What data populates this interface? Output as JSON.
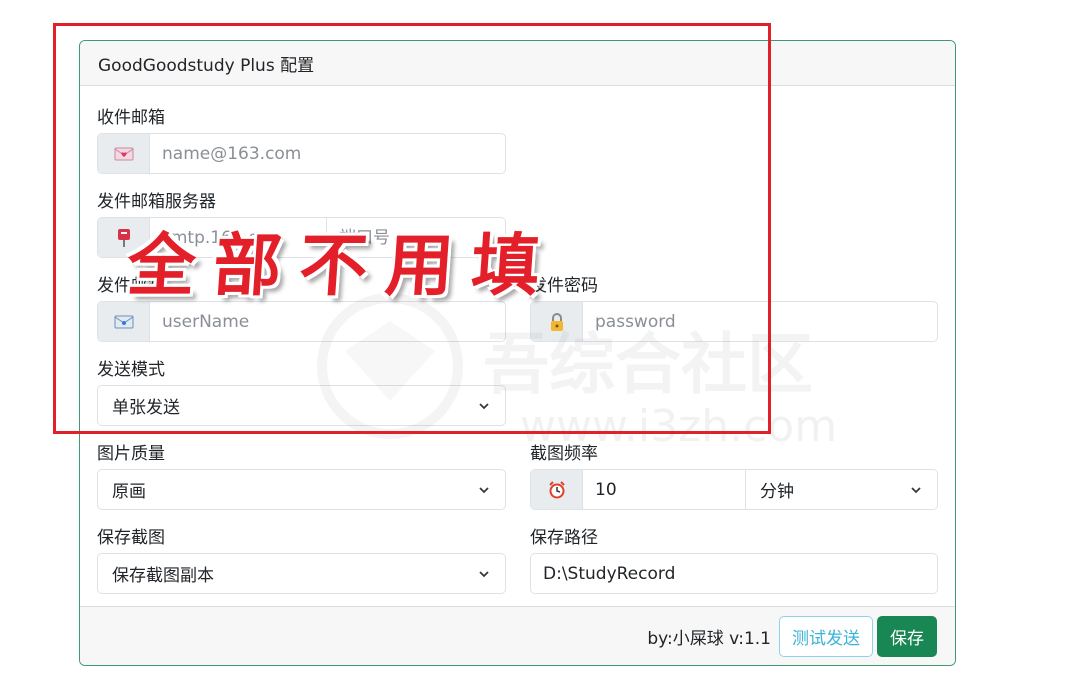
{
  "header": {
    "title": "GoodGoodstudy Plus 配置"
  },
  "fields": {
    "receive_email": {
      "label": "收件邮箱",
      "placeholder": "name@163.com",
      "icon": "love-letter-icon"
    },
    "send_server": {
      "label": "发件邮箱服务器",
      "host_placeholder": "smtp.163.com",
      "port_placeholder": "端口号",
      "icon": "postbox-icon"
    },
    "send_email": {
      "label": "发件邮箱",
      "placeholder": "userName",
      "icon": "envelope-icon"
    },
    "send_password": {
      "label": "发件密码",
      "placeholder": "password",
      "icon": "lock-icon"
    },
    "send_mode": {
      "label": "发送模式",
      "value": "单张发送"
    },
    "image_quality": {
      "label": "图片质量",
      "value": "原画"
    },
    "capture_freq": {
      "label": "截图频率",
      "value": "10",
      "unit": "分钟",
      "icon": "alarm-clock-icon"
    },
    "save_capture": {
      "label": "保存截图",
      "value": "保存截图副本"
    },
    "save_path": {
      "label": "保存路径",
      "value": "D:\\StudyRecord"
    }
  },
  "footer": {
    "version": "by:小屎球 v:1.1",
    "test_label": "测试发送",
    "save_label": "保存"
  },
  "overlay": {
    "text": "全部不用填"
  },
  "watermark": {
    "text": "吾综合社区",
    "url": "www.i3zh.com"
  },
  "colors": {
    "accent": "#198754",
    "border": "#3f9a71",
    "info": "#3ab3d8",
    "overlay_red": "#e0202a"
  }
}
